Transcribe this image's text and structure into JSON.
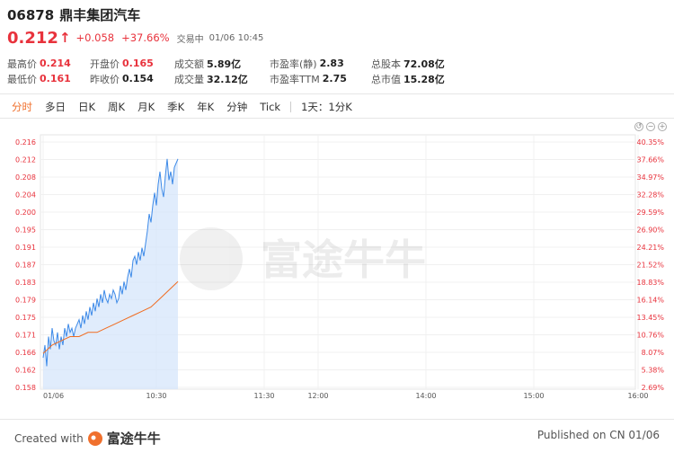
{
  "stock": {
    "code": "06878",
    "name": "鼎丰集团汽车",
    "price": "0.212",
    "change": "+0.058",
    "change_pct": "+37.66%",
    "status": "交易中",
    "time": "01/06 10:45"
  },
  "stats": {
    "row1": [
      {
        "label": "最高价",
        "value": "0.214"
      },
      {
        "label": "开盘价",
        "value": "0.165"
      },
      {
        "label": "成交额",
        "value": "5.89亿"
      },
      {
        "label": "市盈率(静)",
        "value": "2.83"
      },
      {
        "label": "总股本",
        "value": "72.08亿"
      }
    ],
    "row2": [
      {
        "label": "最低价",
        "value": "0.161"
      },
      {
        "label": "昨收价",
        "value": "0.154"
      },
      {
        "label": "成交量",
        "value": "32.12亿"
      },
      {
        "label": "市盈率TTM",
        "value": "2.75"
      },
      {
        "label": "总市值",
        "value": "15.28亿"
      }
    ]
  },
  "tabs": [
    "分时",
    "多日",
    "日K",
    "周K",
    "月K",
    "季K",
    "年K",
    "分钟",
    "Tick",
    "1天：1分K"
  ],
  "active_tab": "分时",
  "colors": {
    "up": "#e8323c",
    "accent": "#f0702d",
    "price_line": "#3d8ae8",
    "avg_line": "#f06b1f"
  },
  "chart_data": {
    "type": "line",
    "y_ticks": [
      "0.216",
      "0.212",
      "0.208",
      "0.204",
      "0.200",
      "0.195",
      "0.191",
      "0.187",
      "0.183",
      "0.179",
      "0.175",
      "0.171",
      "0.166",
      "0.162",
      "0.158"
    ],
    "pct_ticks": [
      "40.35%",
      "37.66%",
      "34.97%",
      "32.28%",
      "29.59%",
      "26.90%",
      "24.21%",
      "21.52%",
      "18.83%",
      "16.14%",
      "13.45%",
      "10.76%",
      "8.07%",
      "5.38%",
      "2.69%"
    ],
    "x_ticks": [
      "01/06",
      "10:30",
      "11:30",
      "12:00",
      "14:00",
      "15:00",
      "16:00"
    ],
    "ylim": [
      0.155,
      0.218
    ],
    "series": [
      {
        "x": [
          0,
          1,
          2,
          3,
          4,
          5,
          6,
          7,
          8,
          9,
          10,
          11,
          12,
          13,
          14,
          15,
          16,
          17,
          18,
          19,
          20,
          21,
          22,
          23,
          24,
          25,
          26,
          27,
          28,
          29,
          30,
          31,
          32,
          33,
          34,
          35,
          36,
          37,
          38,
          39,
          40,
          41,
          42,
          43,
          44,
          45,
          46,
          47,
          48,
          49,
          50,
          51,
          52,
          53,
          54,
          55,
          56,
          57,
          58,
          59,
          60,
          61,
          62,
          63,
          64,
          65,
          66,
          67,
          68,
          69,
          70,
          71,
          72,
          73,
          74,
          75
        ],
        "y": [
          0.165,
          0.168,
          0.163,
          0.17,
          0.167,
          0.172,
          0.169,
          0.168,
          0.171,
          0.167,
          0.17,
          0.168,
          0.172,
          0.17,
          0.173,
          0.171,
          0.172,
          0.17,
          0.172,
          0.173,
          0.174,
          0.172,
          0.175,
          0.173,
          0.176,
          0.174,
          0.177,
          0.175,
          0.178,
          0.176,
          0.179,
          0.177,
          0.18,
          0.178,
          0.181,
          0.179,
          0.178,
          0.18,
          0.179,
          0.181,
          0.18,
          0.178,
          0.179,
          0.182,
          0.18,
          0.183,
          0.181,
          0.184,
          0.186,
          0.184,
          0.188,
          0.189,
          0.187,
          0.19,
          0.188,
          0.191,
          0.189,
          0.192,
          0.195,
          0.199,
          0.197,
          0.201,
          0.204,
          0.201,
          0.206,
          0.209,
          0.205,
          0.203,
          0.208,
          0.212,
          0.207,
          0.209,
          0.206,
          0.21,
          0.211,
          0.212
        ]
      },
      {
        "x": [
          0,
          5,
          10,
          15,
          20,
          25,
          30,
          35,
          40,
          45,
          50,
          55,
          60,
          65,
          70,
          75
        ],
        "y": [
          0.166,
          0.168,
          0.169,
          0.17,
          0.17,
          0.171,
          0.171,
          0.172,
          0.173,
          0.174,
          0.175,
          0.176,
          0.177,
          0.179,
          0.181,
          0.183
        ]
      }
    ]
  },
  "watermark": "富途牛牛",
  "footer": {
    "created_with": "Created with",
    "brand": "富途牛牛",
    "published": "Published on CN 01/06"
  }
}
